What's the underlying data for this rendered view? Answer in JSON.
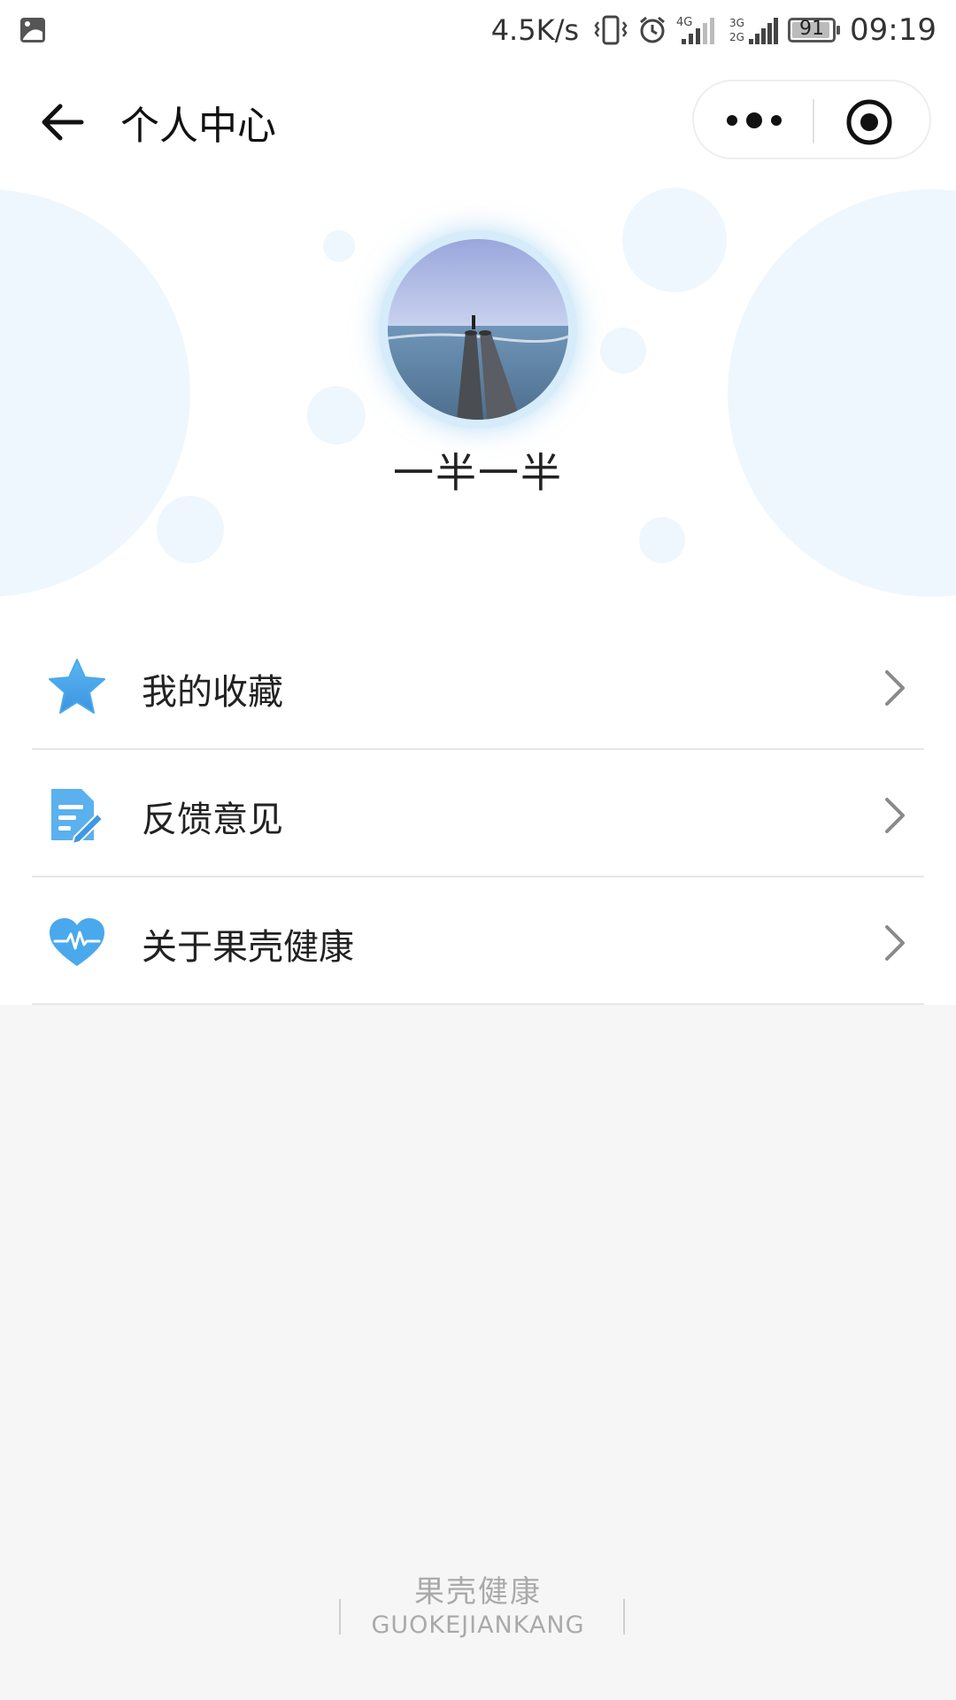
{
  "status_bar": {
    "network_speed": "4.5K/s",
    "signal_1_label": "4G",
    "signal_2_label_top": "3G",
    "signal_2_label_bottom": "2G",
    "battery_level": "91",
    "time": "09:19"
  },
  "nav": {
    "title": "个人中心"
  },
  "profile": {
    "username": "一半一半"
  },
  "menu": {
    "items": [
      {
        "label": "我的收藏",
        "icon": "star-icon"
      },
      {
        "label": "反馈意见",
        "icon": "feedback-document-icon"
      },
      {
        "label": "关于果壳健康",
        "icon": "heart-pulse-icon"
      }
    ]
  },
  "footer": {
    "brand_cn": "果壳健康",
    "brand_en": "GUOKEJIANKANG"
  },
  "colors": {
    "accent_blue": "#4aa8ec",
    "bubble": "#eef7fd",
    "background": "#f6f6f6"
  }
}
